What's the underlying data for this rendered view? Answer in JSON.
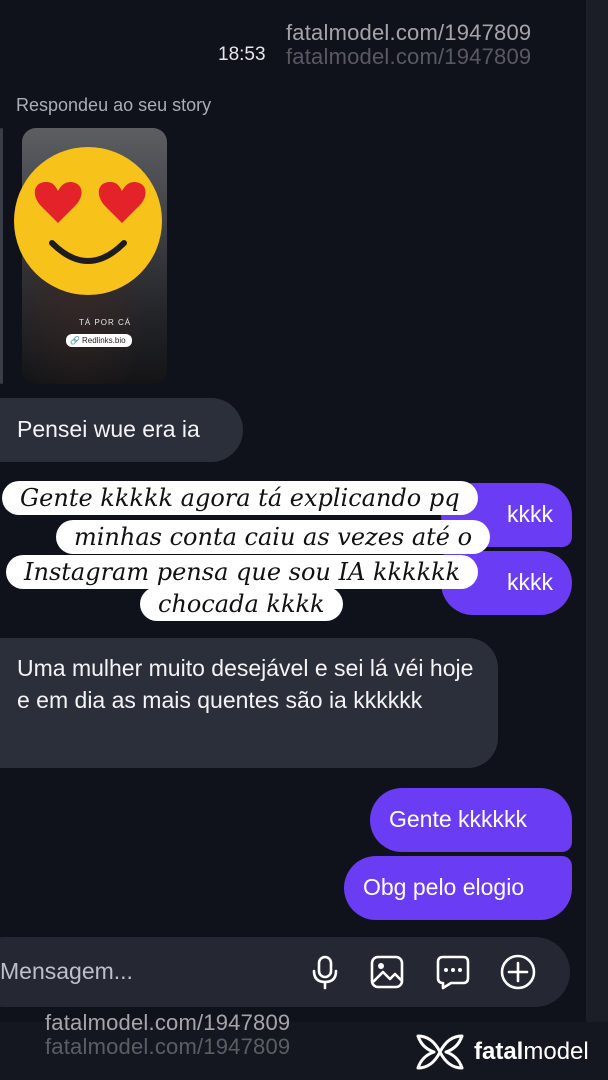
{
  "watermark": {
    "text": "fatalmodel.com/1947809",
    "brand_bold": "fatal",
    "brand_rest": "model"
  },
  "status": {
    "time": "18:53"
  },
  "story": {
    "label": "Respondeu ao seu story",
    "caption": "TÁ POR CÁ",
    "link_chip": "Redlinks.bio"
  },
  "messages": [
    {
      "side": "in",
      "text": "Pensei wue era ia"
    },
    {
      "side": "out",
      "text": "kkkk"
    },
    {
      "side": "out",
      "text": "kkkk"
    },
    {
      "side": "in",
      "text": "Uma mulher muito desejável e sei lá véi hoje e em dia as mais  quentes são ia kkkkkk"
    },
    {
      "side": "out",
      "text": "Gente kkkkkk"
    },
    {
      "side": "out",
      "text": "Obg pelo elogio"
    }
  ],
  "overlay": {
    "lines": [
      "Gente kkkkk agora tá explicando pq",
      "minhas conta caiu as vezes até o",
      "Instagram pensa que sou IA kkkkkk",
      "chocada kkkk"
    ]
  },
  "composer": {
    "placeholder": "Mensagem...",
    "icons": [
      "microphone-icon",
      "image-icon",
      "sticker-icon",
      "plus-icon"
    ]
  },
  "colors": {
    "background": "#0f121b",
    "incoming_bubble": "#2b2f3a",
    "outgoing_bubble": "#6a3cf3",
    "overlay_bg": "#ffffff"
  }
}
